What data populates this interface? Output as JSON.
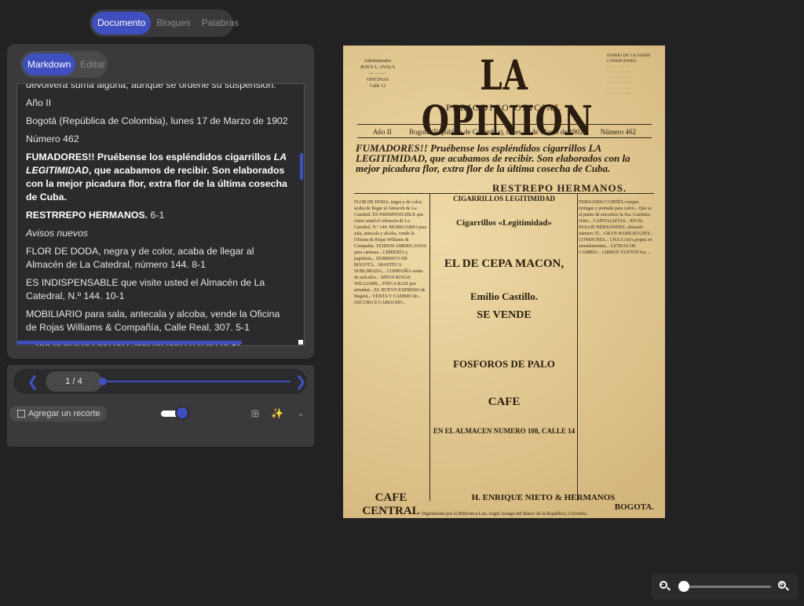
{
  "top_tabs": [
    "Documento",
    "Bloques",
    "Palabras"
  ],
  "sub_tabs": [
    "Markdown",
    "Editar"
  ],
  "text_lines": {
    "l0": "devolverá suma alguna, aunque se ordene su suspensión.",
    "l1": "Año II",
    "l2": "Bogotá (República de Colombia), lunes 17 de Marzo de 1902",
    "l3": "Número 462",
    "l4a": "FUMADORES!! Pruébense los espléndidos cigarrillos ",
    "l4b": "LA LEGITIMIDAD",
    "l4c": ", que acabamos de recibir. Son elaborados con la mejor picadura flor, extra flor de la última cosecha de Cuba.",
    "l5a": "RESTRREPO HERMANOS.",
    "l5b": " 6-1",
    "l6": "Avisos nuevos",
    "l7": "FLOR DE DODA, negra y de color, acaba de llegar al Almacén de La Catedral, número 144. 8-1",
    "l8": "ES INDISPENSABLE que visite usted el Almacén de La Catedral, N.º 144. 10-1",
    "l9": "MOBILIARIO para sala, antecala y alcoba, vende la Oficina de Rojas Williams & Compañía, Calle Real, 307. 5-1",
    "l10": "—Por el mal estado de salud en que se halla el Sr. Hermógenes"
  },
  "pager": {
    "label": "1 / 4",
    "progress": 0.0
  },
  "crop_button": "Agregar un recorte",
  "doc": {
    "masthead": "LA OPINION",
    "subhead": "PERIODICO OFICIAL",
    "year": "Año II",
    "date": "Bogotá (República de Colombia), lunes 17 de Marzo de 1902",
    "number": "Número 462",
    "headline": "FUMADORES!! Pruébense los espléndidos cigarrillos LA LEGITIMIDAD, que acabamos de recibir. Son elaborados con la mejor picadura flor, extra flor de la última cosecha de Cuba.",
    "signature": "RESTREPO HERMANOS.",
    "ad1": "Cigarrillos «Legitimidad»",
    "ad2": "EL DE CEPA MACON,",
    "ad3": "Emilio Castillo.",
    "ad4": "SE VENDE",
    "ad5": "FOSFOROS DE PALO",
    "ad6": "CAFE",
    "ad7": "EN EL ALMACEN NUMERO 108, CALLE 14",
    "ad8": "CAFE CENTRAL",
    "ad9": "H. ENRIQUE NIETO & HERMANOS",
    "ad10": "BOGOTA.",
    "footer": "Digitalizado por la Biblioteca Luis Ángel Arango del Banco de la República, Colombia"
  },
  "colors": {
    "accent": "#3f4fbf",
    "background": "#222222",
    "panel": "#3a3a3c"
  }
}
